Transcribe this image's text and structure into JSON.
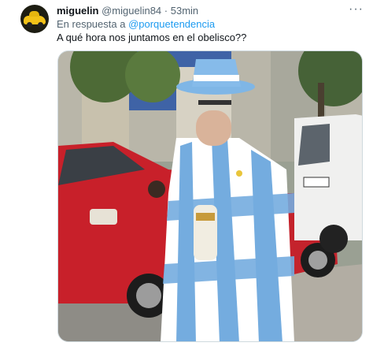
{
  "tweet": {
    "display_name": "miguelin",
    "handle": "@miguelin84",
    "separator": "·",
    "time": "53min",
    "more_label": "···",
    "reply_prefix": "En respuesta a ",
    "reply_to": "@porquetendencia",
    "text": "A qué hora nos juntamos en el obelisco??"
  },
  "icons": {
    "avatar": "yellow-car-avatar",
    "more": "ellipsis-icon"
  },
  "colors": {
    "link": "#1d9bf0",
    "secondary_text": "#536471",
    "primary_text": "#0f1419",
    "flag_blue": "#74acdf"
  }
}
